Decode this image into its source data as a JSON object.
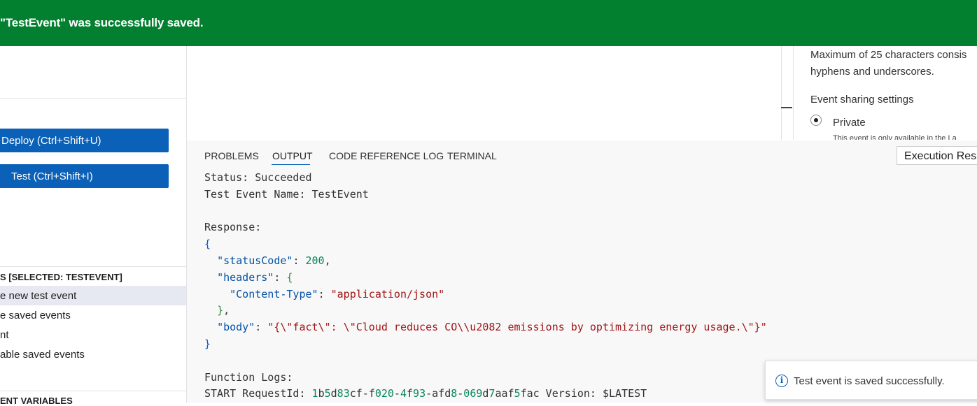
{
  "banner": {
    "message": "\"TestEvent\" was successfully saved."
  },
  "left_panel": {
    "deploy_button": "Deploy (Ctrl+Shift+U)",
    "test_button": "Test (Ctrl+Shift+I)",
    "test_events_header": "S [SELECTED: TESTEVENT]",
    "items": [
      "e new test event",
      "e saved events",
      "nt",
      "able saved events"
    ],
    "env_vars_header": "ENT VARIABLES"
  },
  "right_panel": {
    "hint_line1": "Maximum of 25 characters consis",
    "hint_line2": "hyphens and underscores.",
    "sharing_label": "Event sharing settings",
    "private_label": "Private",
    "private_desc": "This event is only available in the La"
  },
  "output_panel": {
    "tabs": [
      "PROBLEMS",
      "OUTPUT",
      "CODE REFERENCE LOG",
      "TERMINAL"
    ],
    "active_tab": "OUTPUT",
    "view_select": "Execution Resu",
    "status": "Status: Succeeded",
    "test_event_name": "Test Event Name: TestEvent",
    "response_label": "Response:",
    "status_code": 200,
    "content_type": "\"application/json\"",
    "body": "\"{\\\"fact\\\": \\\"Cloud reduces CO\\\\u2082 emissions by optimizing energy usage.\\\"}\"",
    "function_logs_label": "Function Logs:",
    "request_id": "1b5d83cf-f020-4f93-afd8-069d7aaf5fac",
    "version": "$LATEST"
  },
  "toast": {
    "message": "Test event is saved successfully."
  },
  "colors": {
    "success": "#037f30",
    "primary": "#0b60b7"
  }
}
